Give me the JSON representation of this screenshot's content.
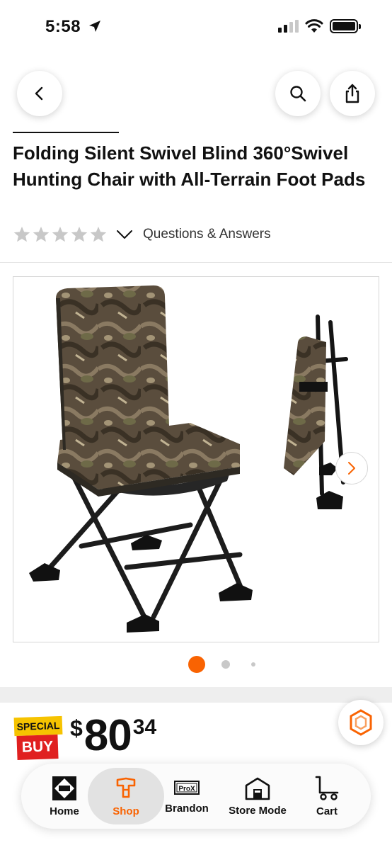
{
  "status_bar": {
    "time": "5:58"
  },
  "header": {
    "back_icon": "chevron-left-icon",
    "search_icon": "search-icon",
    "share_icon": "share-icon"
  },
  "product": {
    "title": "Folding Silent Swivel Blind 360°Swivel Hunting Chair with All-Terrain Foot Pads",
    "rating_stars": 0,
    "rating_max": 5,
    "qa_label": "Questions & Answers"
  },
  "gallery": {
    "image_count": 3,
    "active_index": 0,
    "next_icon": "chevron-right-icon"
  },
  "price": {
    "badge_top": "SPECIAL",
    "badge_bottom": "BUY",
    "currency": "$",
    "dollars": "80",
    "cents": "34"
  },
  "nav": {
    "items": [
      {
        "label": "Home",
        "icon": "home-depot-logo-icon"
      },
      {
        "label": "Shop",
        "icon": "shop-icon",
        "active": true
      },
      {
        "label": "Brandon",
        "icon": "prox-icon",
        "badge": "ProX"
      },
      {
        "label": "Store Mode",
        "icon": "store-icon"
      },
      {
        "label": "Cart",
        "icon": "cart-icon"
      }
    ]
  },
  "colors": {
    "accent": "#f96302",
    "special_yellow": "#f6c300",
    "special_red": "#e02020",
    "star_empty": "#c8c8c8"
  }
}
